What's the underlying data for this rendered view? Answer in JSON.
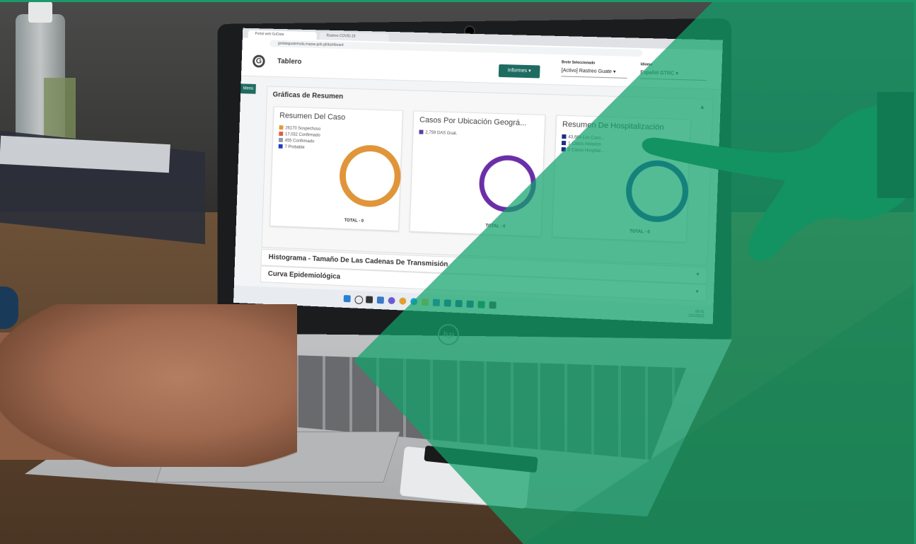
{
  "brand": {
    "accent": "#1e6b62",
    "overlay": "#12a26e"
  },
  "browser": {
    "tabs": [
      "Portal web GoData",
      "Rastreo COVID-19"
    ],
    "url": "godataguatemala.mspas.gob.gt/dashboard"
  },
  "app": {
    "title": "Tablero",
    "informes_label": "Informes",
    "brote_label": "Brote Seleccionado",
    "brote_value": "[Activo] Rastreo Guate",
    "idioma_label": "Idioma",
    "idioma_value": "Español GTRC",
    "menu_label": "Menú"
  },
  "panel": {
    "title": "Gráficas de Resumen",
    "cards": [
      {
        "title": "Resumen Del Caso",
        "legend": [
          {
            "label": "26170 Sospechoso",
            "color": "#e09a3a"
          },
          {
            "label": "17,032 Confirmado",
            "color": "#e0603a"
          },
          {
            "label": "455 Confirmado",
            "color": "#8a9ab0"
          },
          {
            "label": "7 Probable",
            "color": "#1f3fbf"
          }
        ],
        "total": "TOTAL - 0",
        "ring_color": "#e0953a"
      },
      {
        "title": "Casos Por Ubicación Geográ...",
        "legend": [
          {
            "label": "2,759 DAS Guat.",
            "color": "#5a3fa0"
          }
        ],
        "total": "TOTAL - 0",
        "ring_color": "#6a2fa8"
      },
      {
        "title": "Resumen De Hospitalización",
        "legend": [
          {
            "label": "43,664 Los Caso...",
            "color": "#1e2f80"
          },
          {
            "label": "1 Casos Aislados",
            "color": "#1e2f80"
          },
          {
            "label": "0 Casos Hospital...",
            "color": "#1e2f80"
          }
        ],
        "total": "TOTAL - 0",
        "ring_color": "#1e2fa0"
      }
    ]
  },
  "sections": [
    {
      "title": "Histograma - Tamaño De Las Cadenas De Transmisión"
    },
    {
      "title": "Curva Epidemiológica"
    }
  ],
  "taskbar": {
    "clock": "09:41",
    "date": "12/1/2022",
    "lang": "ESP\nLAA"
  },
  "icons": [
    "windows-icon",
    "search-icon",
    "taskview-icon",
    "widgets-icon",
    "chat-icon",
    "chrome-icon",
    "edge-icon",
    "files-icon",
    "store-icon",
    "mail-icon",
    "app-icon",
    "app2-icon",
    "excel-icon",
    "app3-icon"
  ],
  "laptop": {
    "logo": "hp"
  }
}
